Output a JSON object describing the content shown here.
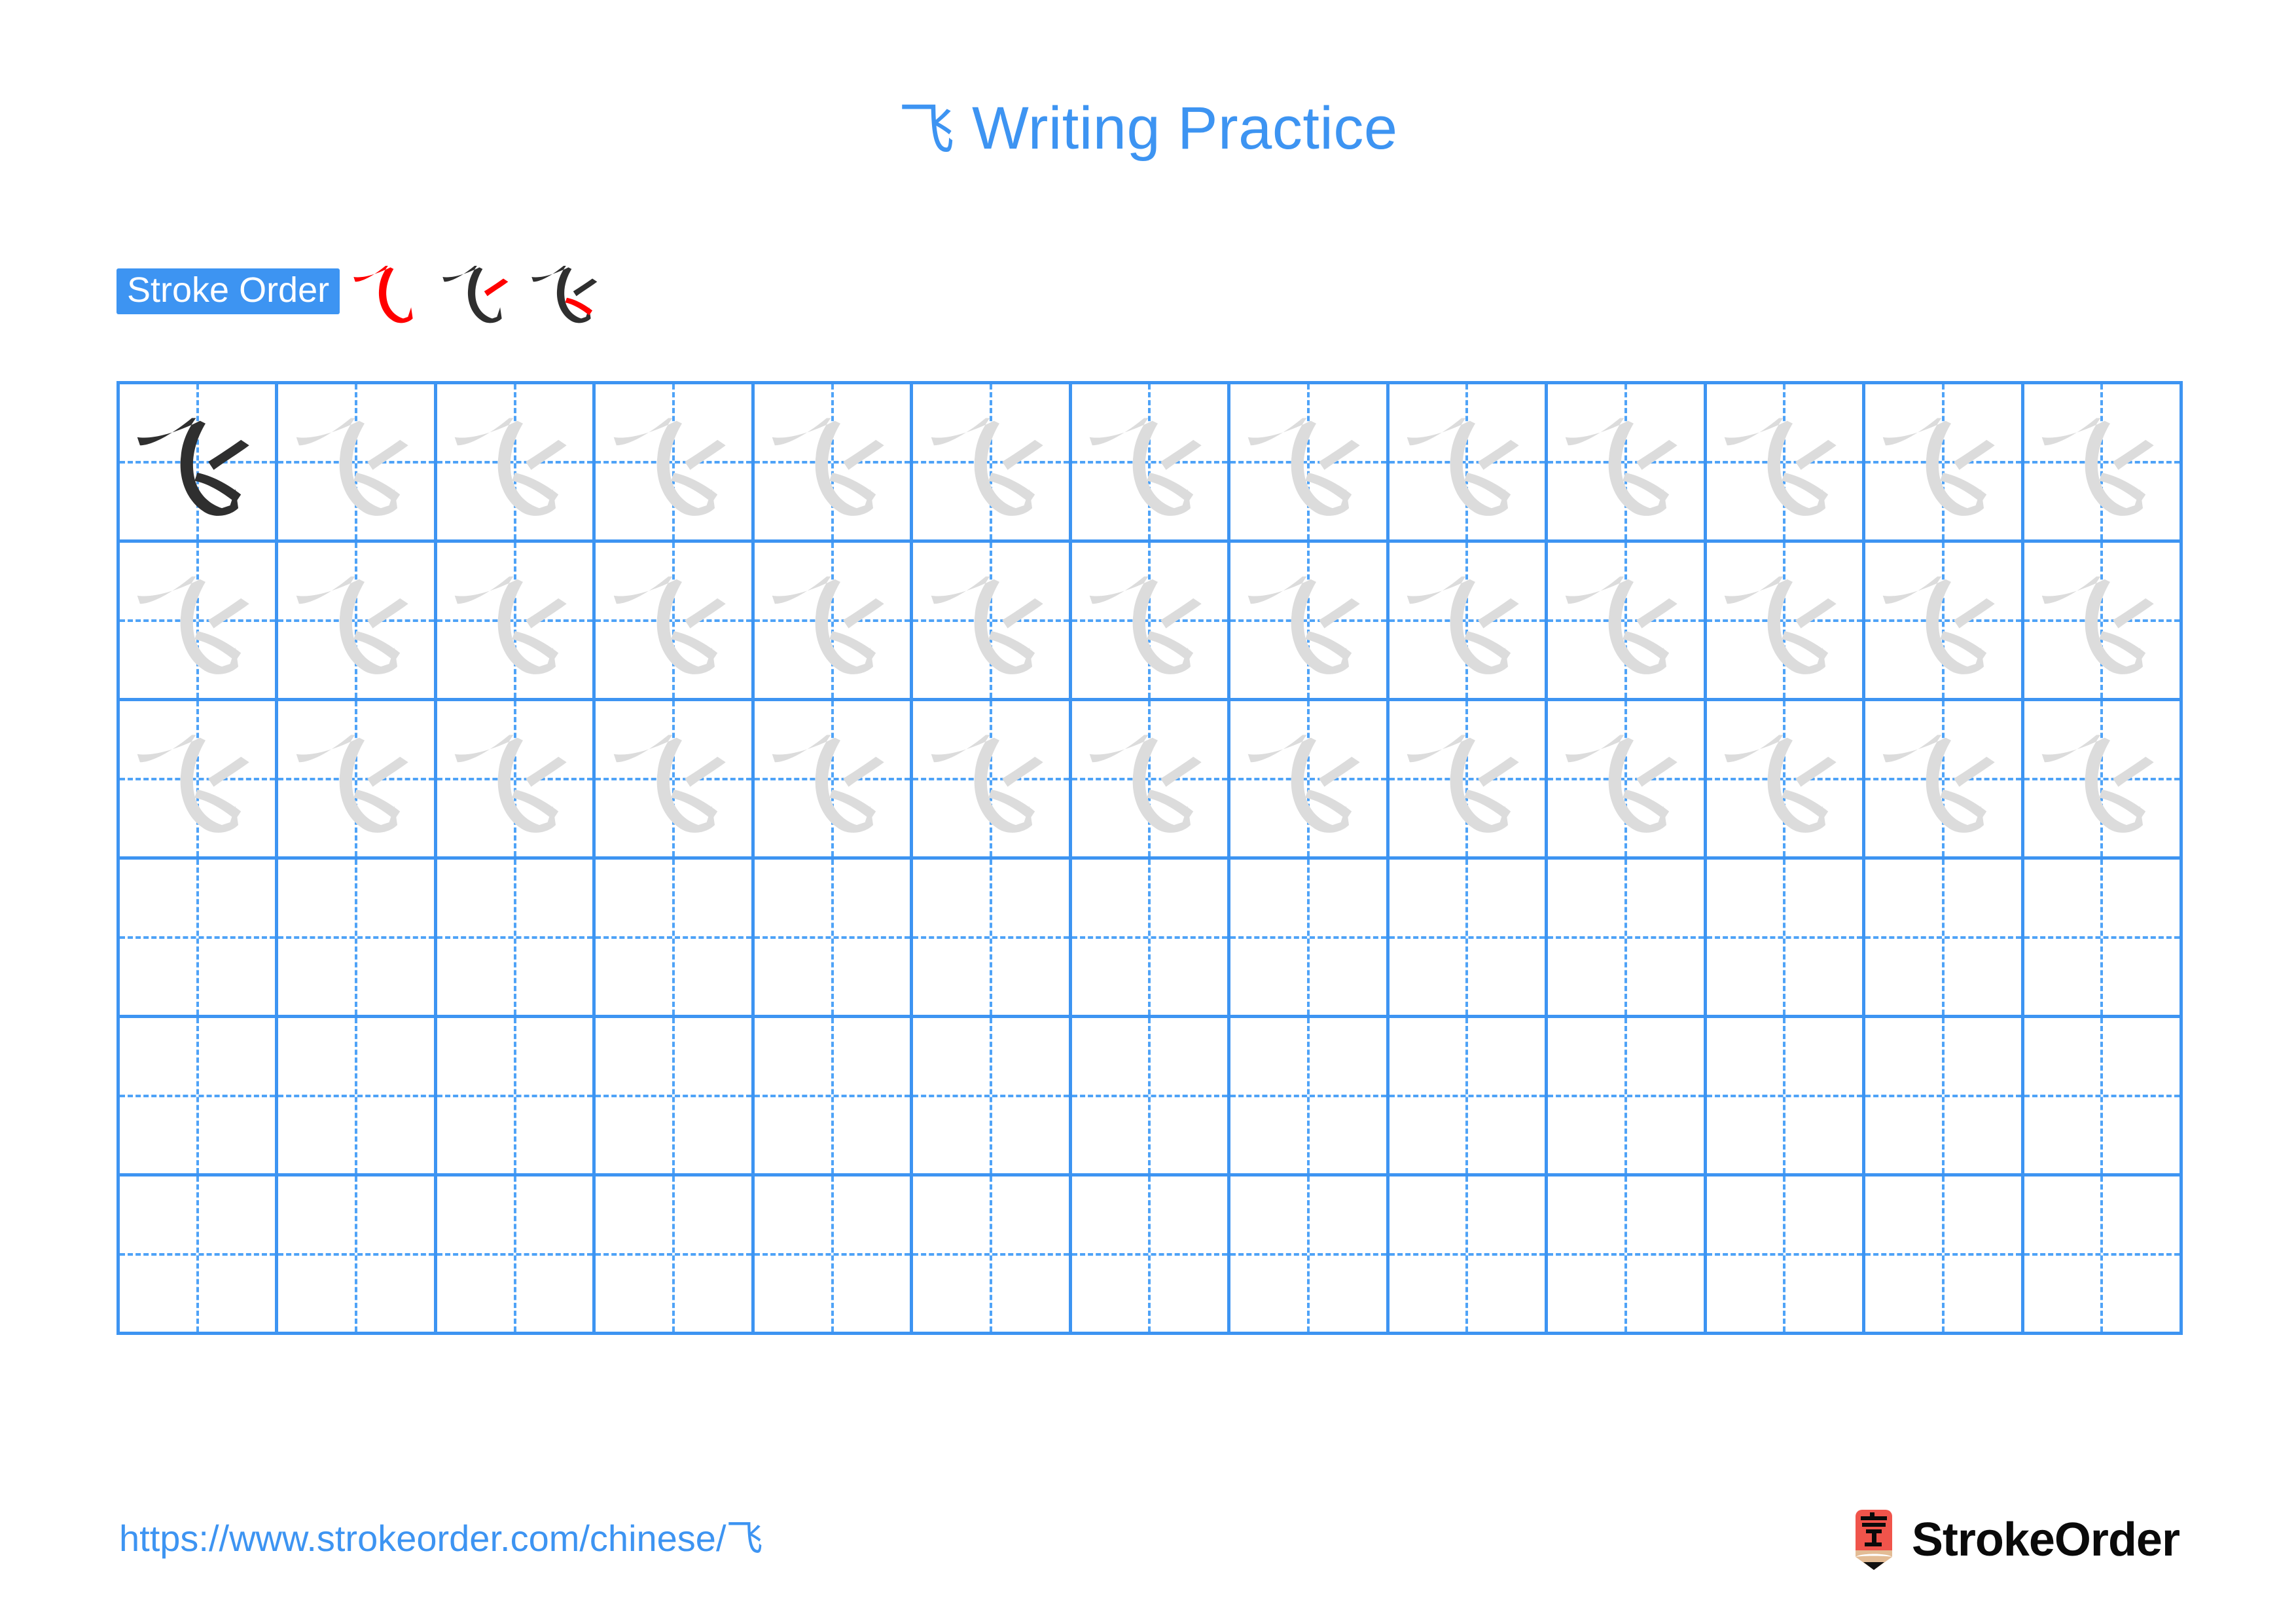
{
  "character": "飞",
  "title": {
    "character": "飞",
    "text": " Writing Practice",
    "full": "飞 Writing Practice",
    "color": "#3d94f2"
  },
  "stroke_order": {
    "badge_label": "Stroke Order",
    "badge_bg": "#3d94f2",
    "badge_text_color": "#ffffff",
    "new_stroke_color": "#ff0000",
    "existing_stroke_color": "#2f2f2f",
    "total_strokes": 3,
    "steps": [
      {
        "index": 1,
        "stroke_name": "heng-xie-gou",
        "new_stroke": 1
      },
      {
        "index": 2,
        "stroke_name": "pie",
        "new_stroke": 2
      },
      {
        "index": 3,
        "stroke_name": "dian",
        "new_stroke": 3
      }
    ]
  },
  "grid": {
    "columns": 13,
    "rows": 6,
    "line_color": "#3d94f2",
    "guide_line_color": "#4fa3f7",
    "traced_color": "#dcdcdc",
    "model_color": "#2f2f2f",
    "model_cell": {
      "row": 1,
      "col": 1
    },
    "rows_with_characters": 3,
    "empty_rows": 3,
    "row_fill": [
      {
        "row": 1,
        "cells": [
          "model",
          "trace",
          "trace",
          "trace",
          "trace",
          "trace",
          "trace",
          "trace",
          "trace",
          "trace",
          "trace",
          "trace",
          "trace"
        ]
      },
      {
        "row": 2,
        "cells": [
          "trace",
          "trace",
          "trace",
          "trace",
          "trace",
          "trace",
          "trace",
          "trace",
          "trace",
          "trace",
          "trace",
          "trace",
          "trace"
        ]
      },
      {
        "row": 3,
        "cells": [
          "trace",
          "trace",
          "trace",
          "trace",
          "trace",
          "trace",
          "trace",
          "trace",
          "trace",
          "trace",
          "trace",
          "trace",
          "trace"
        ]
      },
      {
        "row": 4,
        "cells": [
          "empty",
          "empty",
          "empty",
          "empty",
          "empty",
          "empty",
          "empty",
          "empty",
          "empty",
          "empty",
          "empty",
          "empty",
          "empty"
        ]
      },
      {
        "row": 5,
        "cells": [
          "empty",
          "empty",
          "empty",
          "empty",
          "empty",
          "empty",
          "empty",
          "empty",
          "empty",
          "empty",
          "empty",
          "empty",
          "empty"
        ]
      },
      {
        "row": 6,
        "cells": [
          "empty",
          "empty",
          "empty",
          "empty",
          "empty",
          "empty",
          "empty",
          "empty",
          "empty",
          "empty",
          "empty",
          "empty",
          "empty"
        ]
      }
    ]
  },
  "footer": {
    "url_prefix": "https://www.strokeorder.com/chinese/",
    "url_character": "飞",
    "url_color": "#3d94f2",
    "brand_name": "StrokeOrder",
    "logo_char": "字",
    "logo_bg": "#f0544b",
    "logo_tip": "#e3bc95",
    "logo_point": "#111111"
  }
}
